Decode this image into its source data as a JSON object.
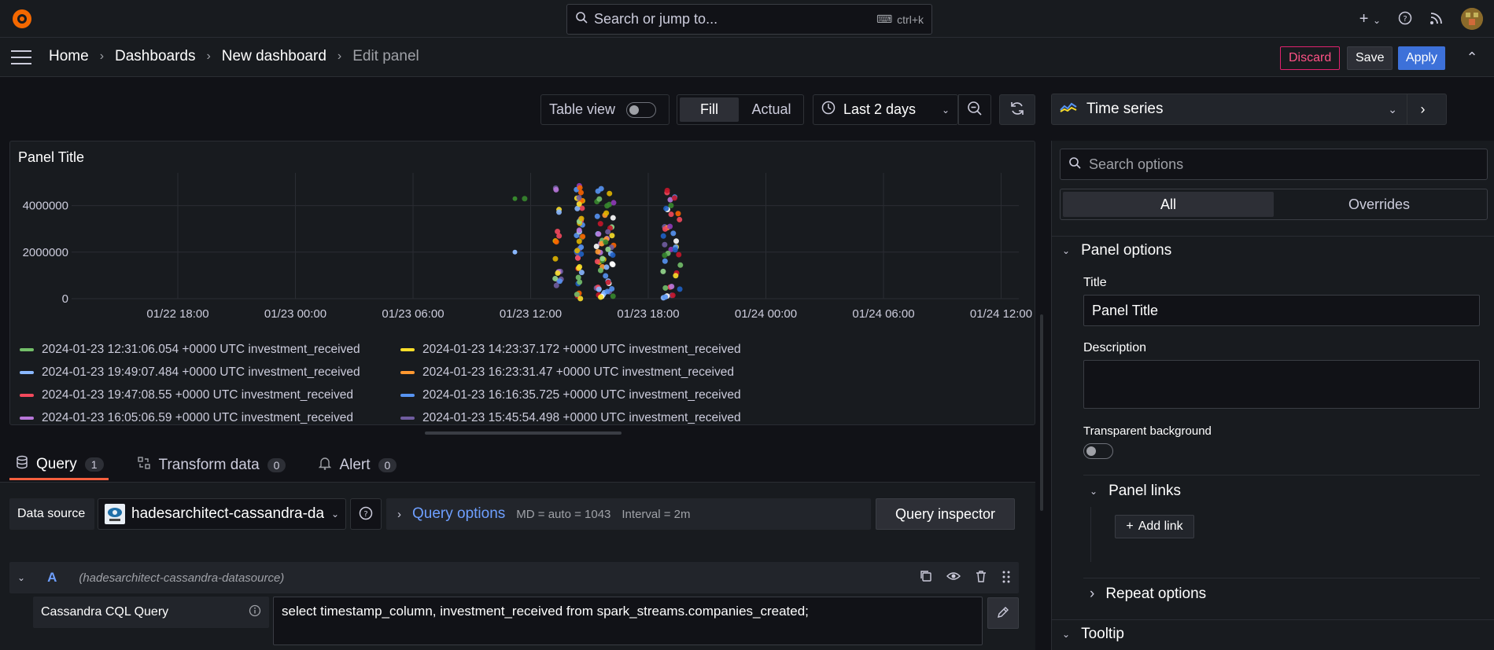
{
  "search": {
    "placeholder": "Search or jump to...",
    "shortcut": "ctrl+k"
  },
  "breadcrumb": {
    "home": "Home",
    "dashboards": "Dashboards",
    "dashboard": "New dashboard",
    "current": "Edit panel"
  },
  "actions": {
    "discard": "Discard",
    "save": "Save",
    "apply": "Apply"
  },
  "toolbar": {
    "table_view": "Table view",
    "fill": "Fill",
    "actual": "Actual",
    "time_range": "Last 2 days"
  },
  "viz": {
    "name": "Time series"
  },
  "panel": {
    "title": "Panel Title"
  },
  "chart_data": {
    "type": "scatter",
    "title": "Panel Title",
    "x_ticks": [
      "01/22 18:00",
      "01/23 00:00",
      "01/23 06:00",
      "01/23 12:00",
      "01/23 18:00",
      "01/24 00:00",
      "01/24 06:00",
      "01/24 12:00"
    ],
    "y_ticks": [
      "0",
      "2000000",
      "4000000"
    ],
    "ylim": [
      0,
      5000000
    ],
    "grid": true,
    "legend_placement": "bottom",
    "series": [
      {
        "name": "2024-01-23 12:31:06.054 +0000 UTC investment_received",
        "color": "#73bf69"
      },
      {
        "name": "2024-01-23 14:23:37.172 +0000 UTC investment_received",
        "color": "#fade2a"
      },
      {
        "name": "2024-01-23 19:49:07.484 +0000 UTC investment_received",
        "color": "#8ab8ff"
      },
      {
        "name": "2024-01-23 16:23:31.47 +0000 UTC investment_received",
        "color": "#ff9830"
      },
      {
        "name": "2024-01-23 19:47:08.55 +0000 UTC investment_received",
        "color": "#f2495c"
      },
      {
        "name": "2024-01-23 16:16:35.725 +0000 UTC investment_received",
        "color": "#5794f2"
      },
      {
        "name": "2024-01-23 16:05:06.59 +0000 UTC investment_received",
        "color": "#b877d9"
      },
      {
        "name": "2024-01-23 15:45:54.498 +0000 UTC investment_received",
        "color": "#705da0"
      }
    ],
    "clusters_hours_from_start": [
      18.5,
      20.2,
      21.3,
      22.6,
      26.0
    ],
    "cluster_point_counts": [
      1,
      18,
      45,
      60,
      40
    ],
    "point_colors": [
      "#73bf69",
      "#fade2a",
      "#8ab8ff",
      "#ff9830",
      "#f2495c",
      "#5794f2",
      "#b877d9",
      "#705da0",
      "#37872d",
      "#ffffff",
      "#fa6400",
      "#c4162a",
      "#1f60c4",
      "#8f3bb8",
      "#e0b400",
      "#96d98d"
    ]
  },
  "tabs": [
    {
      "label": "Query",
      "count": "1"
    },
    {
      "label": "Transform data",
      "count": "0"
    },
    {
      "label": "Alert",
      "count": "0"
    }
  ],
  "datasource": {
    "label": "Data source",
    "name": "hadesarchitect-cassandra-da"
  },
  "query_options": {
    "label": "Query options",
    "md": "MD = auto = 1043",
    "interval": "Interval = 2m"
  },
  "query_inspector": "Query inspector",
  "query": {
    "ref": "A",
    "datasource": "(hadesarchitect-cassandra-datasource)",
    "cql_label": "Cassandra CQL Query",
    "cql": "select timestamp_column, investment_received from spark_streams.companies_created;"
  },
  "options": {
    "search_placeholder": "Search options",
    "tab_all": "All",
    "tab_overrides": "Overrides",
    "panel_options": "Panel options",
    "title_label": "Title",
    "title_value": "Panel Title",
    "description_label": "Description",
    "transparent_label": "Transparent background",
    "panel_links": "Panel links",
    "add_link": "Add link",
    "repeat_options": "Repeat options",
    "tooltip": "Tooltip"
  }
}
